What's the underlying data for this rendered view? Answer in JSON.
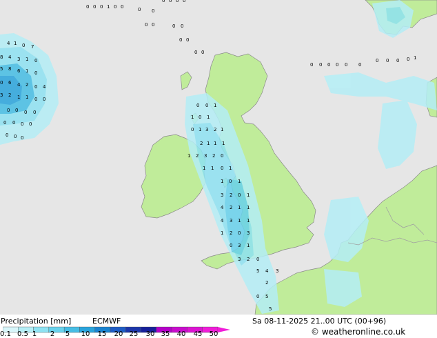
{
  "header": {
    "product": "Precipitation [mm]",
    "model": "ECMWF",
    "valid_time": "Sa 08-11-2025 21..00 UTC (00+96)",
    "site": "© weatheronline.co.uk"
  },
  "legend": {
    "ticks": [
      "0.1",
      "0.5",
      "1",
      "2",
      "5",
      "10",
      "15",
      "20",
      "25",
      "30",
      "35",
      "40",
      "45",
      "50"
    ],
    "colors": [
      "#d8f6fa",
      "#b4eef6",
      "#8ee2f2",
      "#68d2ec",
      "#46bde4",
      "#2aa4dc",
      "#1a84d0",
      "#1e5cc4",
      "#1c36aa",
      "#16209a",
      "#b400c8",
      "#c80ccc",
      "#dc14d2",
      "#f01cd8"
    ]
  },
  "colors": {
    "sea": "#e6e6e6",
    "land": "#c0ec9a",
    "coast": "#8a8a8a",
    "border": "#a0a0a0"
  },
  "stations": [
    "0",
    "0",
    "0",
    "1",
    "0",
    "0",
    "0",
    "0",
    "0",
    "0",
    "0",
    "0",
    "0",
    "0",
    "0",
    "0",
    "0",
    "0",
    "0",
    "0",
    "0",
    "0",
    "1",
    "1",
    "0",
    "1",
    "0",
    "1",
    "3",
    "2",
    "1",
    "2",
    "1",
    "1",
    "1",
    "1",
    "2",
    "3",
    "2",
    "0",
    "1",
    "1",
    "0",
    "1",
    "1",
    "0",
    "1",
    "3",
    "2",
    "0",
    "1",
    "4",
    "2",
    "1",
    "1",
    "4",
    "3",
    "1",
    "1",
    "1",
    "2",
    "0",
    "3",
    "0",
    "3",
    "1",
    "3",
    "2",
    "0",
    "5",
    "4",
    "3",
    "2",
    "0",
    "5",
    "5",
    "4",
    "1",
    "0",
    "7",
    "8",
    "4",
    "3",
    "1",
    "0",
    "5",
    "8",
    "6",
    "1",
    "0",
    "0",
    "6",
    "4",
    "2",
    "0",
    "4",
    "3",
    "2",
    "1",
    "1",
    "0",
    "0",
    "0",
    "0",
    "0",
    "0",
    "0",
    "0",
    "0",
    "0",
    "0",
    "0",
    "0",
    "0",
    "0",
    "0",
    "0",
    "0",
    "0",
    "0"
  ]
}
